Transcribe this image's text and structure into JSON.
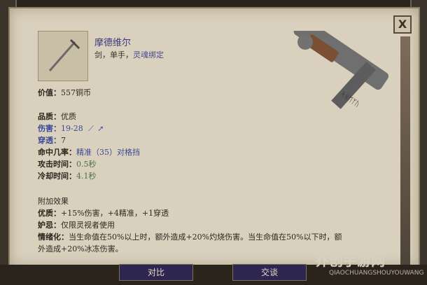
{
  "item": {
    "title": "摩德维尔",
    "subtitle_prefix": "剑，单手，",
    "subtitle_soul": "灵魂绑定",
    "value_label": "价值：",
    "value": "557铜币",
    "quality_label": "品质：",
    "quality": "优质",
    "damage_label": "伤害：",
    "damage": "19-28",
    "pierce_label": "穿透：",
    "pierce": "7",
    "hit_label": "命中几率：",
    "hit_value": "精准（35）对格挡",
    "attack_label": "攻击时间：",
    "attack_value": "0.5秒",
    "cooldown_label": "冷却时间：",
    "cooldown_value": "4.1秒",
    "effects_title": "附加效果",
    "excellent_label": "优质：",
    "excellent_text": "+15%伤害，+4精准，+1穿透",
    "restrict_label": "妒忌：",
    "restrict_text": "仅限灵视者使用",
    "emotion_label": "情绪化：",
    "emotion_text_1": "当生命值在50%以上时，额外造成+20%灼烧伤害。当生命值在50%以下时，额",
    "emotion_text_2": "外造成+20%冰冻伤害。"
  },
  "buttons": {
    "compare": "对比",
    "trade": "交谈"
  },
  "watermark": {
    "main": "乔创手游网",
    "sub": "QIAOCHUANGSHOUYOUWANG"
  }
}
